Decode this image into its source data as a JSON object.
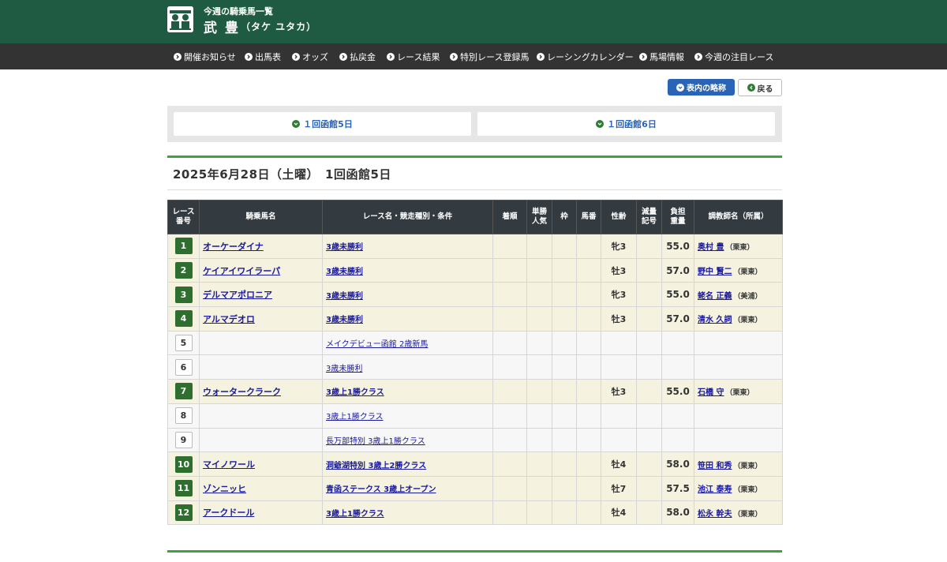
{
  "header": {
    "subtitle": "今週の騎乗馬一覧",
    "name": "武 豊",
    "kana": "（タケ ユタカ）"
  },
  "nav": [
    "開催お知らせ",
    "出馬表",
    "オッズ",
    "払戻金",
    "レース結果",
    "特別レース登録馬",
    "レーシングカレンダー",
    "馬場情報",
    "今週の注目レース"
  ],
  "buttons": {
    "abbr": "表内の略称",
    "back": "戻る"
  },
  "day_tabs": [
    "１回函館5日",
    "１回函館6日"
  ],
  "section_title": "2025年6月28日（土曜）　1回函館5日",
  "table": {
    "headers": {
      "race_no": "レース番号",
      "horse": "騎乗馬名",
      "race": "レース名・競走種別・条件",
      "finish": "着順",
      "pop": "単勝人気",
      "waku": "枠",
      "umaban": "馬番",
      "sexage": "性齢",
      "reduce": "減量記号",
      "weight": "負担重量",
      "trainer": "調教師名（所属）"
    },
    "rows": [
      {
        "no": "1",
        "horse": "オーケーダイナ",
        "race": "3歳未勝利",
        "sexage": "牝3",
        "weight": "55.0",
        "trainer": "奥村 豊",
        "aff": "（栗東）"
      },
      {
        "no": "2",
        "horse": "ケイアイワイラーパ",
        "race": "3歳未勝利",
        "sexage": "牡3",
        "weight": "57.0",
        "trainer": "野中 賢二",
        "aff": "（栗東）"
      },
      {
        "no": "3",
        "horse": "デルマアポロニア",
        "race": "3歳未勝利",
        "sexage": "牝3",
        "weight": "55.0",
        "trainer": "蛯名 正義",
        "aff": "（美浦）"
      },
      {
        "no": "4",
        "horse": "アルマデオロ",
        "race": "3歳未勝利",
        "sexage": "牡3",
        "weight": "57.0",
        "trainer": "清水 久詞",
        "aff": "（栗東）"
      },
      {
        "no": "5",
        "horse": "",
        "race": "メイクデビュー函館 2歳新馬",
        "sexage": "",
        "weight": "",
        "trainer": "",
        "aff": ""
      },
      {
        "no": "6",
        "horse": "",
        "race": "3歳未勝利",
        "sexage": "",
        "weight": "",
        "trainer": "",
        "aff": ""
      },
      {
        "no": "7",
        "horse": "ウォータークラーク",
        "race": "3歳上1勝クラス",
        "sexage": "牡3",
        "weight": "55.0",
        "trainer": "石橋 守",
        "aff": "（栗東）"
      },
      {
        "no": "8",
        "horse": "",
        "race": "3歳上1勝クラス",
        "sexage": "",
        "weight": "",
        "trainer": "",
        "aff": ""
      },
      {
        "no": "9",
        "horse": "",
        "race": "長万部特別 3歳上1勝クラス",
        "sexage": "",
        "weight": "",
        "trainer": "",
        "aff": ""
      },
      {
        "no": "10",
        "horse": "マイノワール",
        "race": "洞爺湖特別 3歳上2勝クラス",
        "sexage": "牡4",
        "weight": "58.0",
        "trainer": "笹田 和秀",
        "aff": "（栗東）"
      },
      {
        "no": "11",
        "horse": "ゾンニッヒ",
        "race": "青函ステークス 3歳上オープン",
        "sexage": "牡7",
        "weight": "57.5",
        "trainer": "池江 泰寿",
        "aff": "（栗東）"
      },
      {
        "no": "12",
        "horse": "アークドール",
        "race": "3歳上1勝クラス",
        "sexage": "牡4",
        "weight": "58.0",
        "trainer": "松永 幹夫",
        "aff": "（栗東）"
      }
    ]
  }
}
